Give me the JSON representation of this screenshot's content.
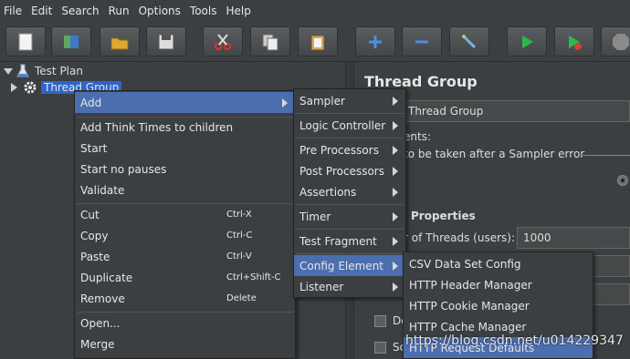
{
  "menubar": {
    "items": [
      "File",
      "Edit",
      "Search",
      "Run",
      "Options",
      "Tools",
      "Help"
    ]
  },
  "toolbar": {
    "buttons": [
      "new-icon",
      "templates-icon",
      "open-icon",
      "save-icon",
      "cut-icon",
      "copy-icon",
      "paste-icon",
      "expand-icon",
      "collapse-icon",
      "toggle-icon",
      "start-icon",
      "start-no-pauses-icon",
      "stop-icon"
    ]
  },
  "tree": {
    "root": "Test Plan",
    "child": "Thread Group"
  },
  "right_panel": {
    "title": "Thread Group",
    "name_value": "Thread Group",
    "comments_label": "ents:",
    "error_label": "to be taken after a Sampler error",
    "properties_label": "Properties",
    "threads_label": "r of Threads (users):",
    "threads_value": "1000",
    "delay_label": "De",
    "sched_label": "Sc"
  },
  "context_menu": {
    "items": [
      {
        "label": "Add",
        "submenu": true
      },
      {
        "label": "Add Think Times to children"
      },
      {
        "label": "Start"
      },
      {
        "label": "Start no pauses"
      },
      {
        "label": "Validate"
      },
      {
        "label": "Cut",
        "shortcut": "Ctrl-X"
      },
      {
        "label": "Copy",
        "shortcut": "Ctrl-C"
      },
      {
        "label": "Paste",
        "shortcut": "Ctrl-V"
      },
      {
        "label": "Duplicate",
        "shortcut": "Ctrl+Shift-C"
      },
      {
        "label": "Remove",
        "shortcut": "Delete"
      },
      {
        "label": "Open..."
      },
      {
        "label": "Merge"
      }
    ]
  },
  "add_submenu": {
    "items": [
      "Sampler",
      "Logic Controller",
      "Pre Processors",
      "Post Processors",
      "Assertions",
      "Timer",
      "Test Fragment",
      "Config Element",
      "Listener"
    ]
  },
  "config_submenu": {
    "items": [
      "CSV Data Set Config",
      "HTTP Header Manager",
      "HTTP Cookie Manager",
      "HTTP Cache Manager",
      "HTTP Request Defaults"
    ]
  },
  "watermark": "https://blog.csdn.net/u014229347"
}
